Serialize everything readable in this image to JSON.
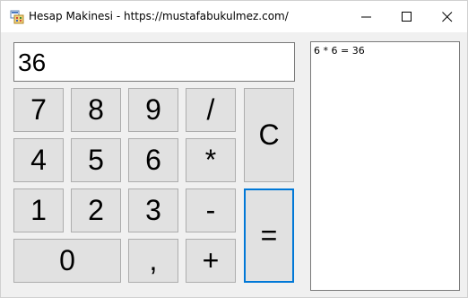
{
  "window": {
    "title": "Hesap Makinesi - https://mustafabukulmez.com/"
  },
  "display": {
    "value": "36"
  },
  "keys": {
    "k7": "7",
    "k8": "8",
    "k9": "9",
    "div": "/",
    "k4": "4",
    "k5": "5",
    "k6": "6",
    "mul": "*",
    "k1": "1",
    "k2": "2",
    "k3": "3",
    "sub": "-",
    "k0": "0",
    "comma": ",",
    "add": "+",
    "clear": "C",
    "equals": "="
  },
  "history": {
    "items": [
      "6 * 6 = 36"
    ]
  },
  "icons": {
    "app": "calculator-app-icon",
    "minimize": "minimize-icon",
    "maximize": "maximize-icon",
    "close": "close-icon"
  },
  "colors": {
    "accent": "#0078d7",
    "button_face": "#e1e1e1",
    "window_bg": "#f0f0f0"
  }
}
